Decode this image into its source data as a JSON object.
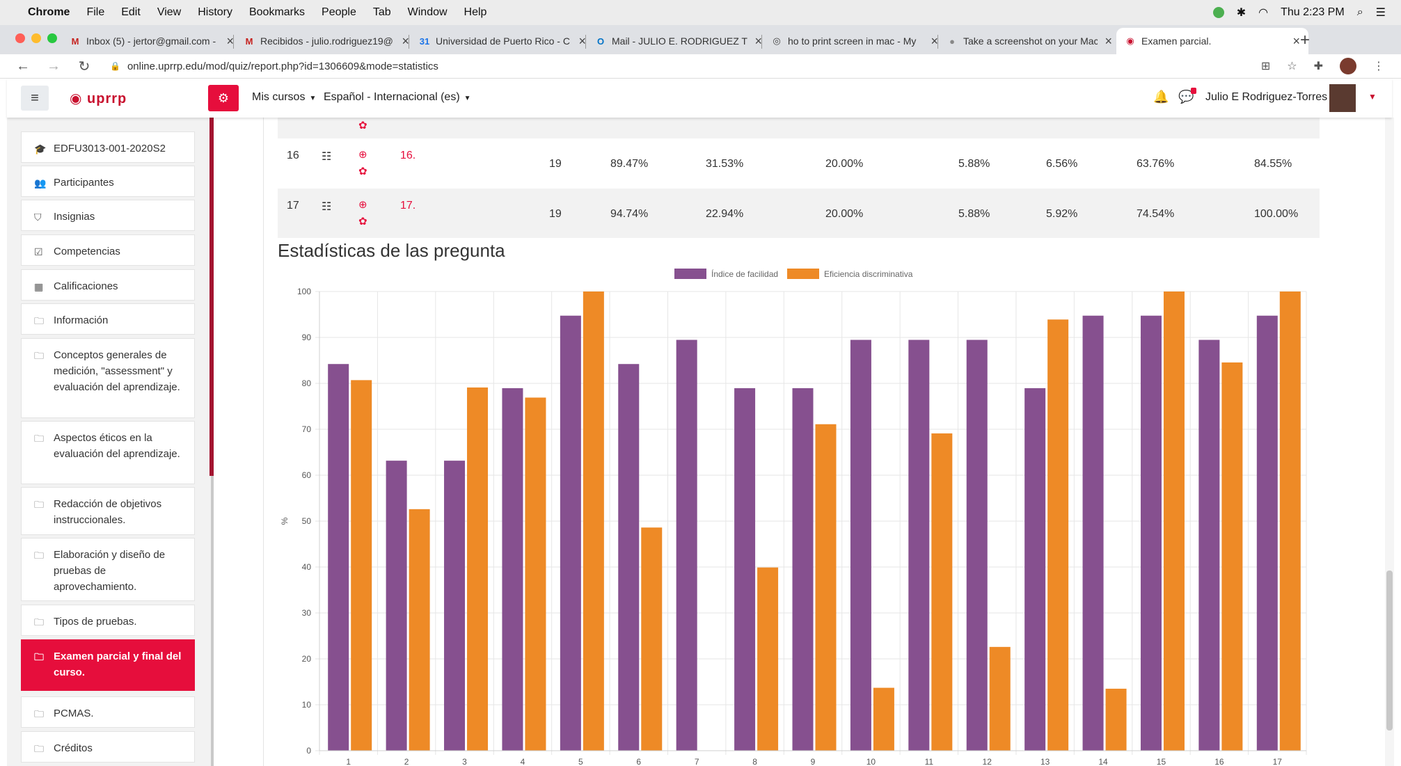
{
  "macmenu": {
    "app": "Chrome",
    "items": [
      "File",
      "Edit",
      "View",
      "History",
      "Bookmarks",
      "People",
      "Tab",
      "Window",
      "Help"
    ],
    "time": "Thu 2:23 PM"
  },
  "tabs": [
    {
      "title": "Inbox (5) - jertor@gmail.com -",
      "icon": "gmail-icon",
      "glyph": "M",
      "color": "#c5221f"
    },
    {
      "title": "Recibidos - julio.rodriguez19@",
      "icon": "gmail-icon",
      "glyph": "M",
      "color": "#c5221f"
    },
    {
      "title": "Universidad de Puerto Rico - C",
      "icon": "calendar-icon",
      "glyph": "31",
      "color": "#1a73e8"
    },
    {
      "title": "Mail - JULIO E. RODRIGUEZ TC",
      "icon": "outlook-icon",
      "glyph": "O",
      "color": "#0072c6"
    },
    {
      "title": "ho to print screen in mac - My",
      "icon": "globe-icon",
      "glyph": "◎",
      "color": "#444"
    },
    {
      "title": "Take a screenshot on your Mac",
      "icon": "apple-icon",
      "glyph": "●",
      "color": "#888"
    },
    {
      "title": "Examen parcial.",
      "icon": "uprrp-icon",
      "glyph": "◉",
      "color": "#c8102e"
    }
  ],
  "address": {
    "url": "online.uprrp.edu/mod/quiz/report.php?id=1306609&mode=statistics"
  },
  "header": {
    "logo": "uprrp",
    "mis_cursos": "Mis cursos",
    "language": "Español - Internacional (es)",
    "user": "Julio E Rodriguez-Torres"
  },
  "sidebar": {
    "items": [
      {
        "label": "EDFU3013-001-2020S2",
        "icon": "graduation-cap-icon",
        "glyph": "🎓"
      },
      {
        "label": "Participantes",
        "icon": "users-icon",
        "glyph": "👥"
      },
      {
        "label": "Insignias",
        "icon": "shield-icon",
        "glyph": "⛉"
      },
      {
        "label": "Competencias",
        "icon": "check-square-icon",
        "glyph": "☑"
      },
      {
        "label": "Calificaciones",
        "icon": "table-icon",
        "glyph": "▦"
      },
      {
        "label": "Información",
        "icon": "folder-icon",
        "glyph": "🗀"
      },
      {
        "label": "Conceptos generales de medición, \"assessment\" y evaluación del aprendizaje.",
        "icon": "folder-icon",
        "glyph": "🗀"
      },
      {
        "label": "Aspectos éticos en la evaluación del aprendizaje.",
        "icon": "folder-icon",
        "glyph": "🗀"
      },
      {
        "label": "Redacción de objetivos instruccionales.",
        "icon": "folder-icon",
        "glyph": "🗀"
      },
      {
        "label": "Elaboración y diseño de pruebas de aprovechamiento.",
        "icon": "folder-icon",
        "glyph": "🗀"
      },
      {
        "label": "Tipos de pruebas.",
        "icon": "folder-icon",
        "glyph": "🗀"
      },
      {
        "label": "Examen parcial y final del curso.",
        "icon": "folder-icon",
        "glyph": "🗀",
        "active": true
      },
      {
        "label": "PCMAS.",
        "icon": "folder-icon",
        "glyph": "🗀"
      },
      {
        "label": "Créditos",
        "icon": "folder-icon",
        "glyph": "🗀"
      }
    ]
  },
  "table": {
    "rows": [
      {
        "num": "16",
        "name": "16.",
        "attempts": "19",
        "facility": "89.47%",
        "sd": "31.53%",
        "random": "20.00%",
        "intended": "5.88%",
        "effective": "6.56%",
        "disc_index": "63.76%",
        "disc_eff": "84.55%",
        "shaded": false
      },
      {
        "num": "17",
        "name": "17.",
        "attempts": "19",
        "facility": "94.74%",
        "sd": "22.94%",
        "random": "20.00%",
        "intended": "5.88%",
        "effective": "5.92%",
        "disc_index": "74.54%",
        "disc_eff": "100.00%",
        "shaded": true
      }
    ]
  },
  "stats_title": "Estadísticas de las pregunta",
  "chart_data": {
    "type": "bar",
    "categories": [
      "1",
      "2",
      "3",
      "4",
      "5",
      "6",
      "7",
      "8",
      "9",
      "10",
      "11",
      "12",
      "13",
      "14",
      "15",
      "16",
      "17"
    ],
    "series": [
      {
        "name": "Índice de facilidad",
        "color": "#86508f",
        "values": [
          84.21,
          63.16,
          63.16,
          78.95,
          94.74,
          84.21,
          89.47,
          78.95,
          78.95,
          89.47,
          89.47,
          89.47,
          78.95,
          94.74,
          94.74,
          89.47,
          94.74
        ]
      },
      {
        "name": "Eficiencia discriminativa",
        "color": "#ee8a26",
        "values": [
          80.7,
          52.6,
          79.1,
          76.9,
          100,
          48.6,
          0,
          39.9,
          71.1,
          13.7,
          69.1,
          22.6,
          93.9,
          13.5,
          100,
          84.55,
          100
        ]
      }
    ],
    "ylabel": "%",
    "ylim": [
      0,
      100
    ],
    "yticks": [
      0,
      10,
      20,
      30,
      40,
      50,
      60,
      70,
      80,
      90,
      100
    ],
    "grid": true,
    "legend": "top-center"
  }
}
